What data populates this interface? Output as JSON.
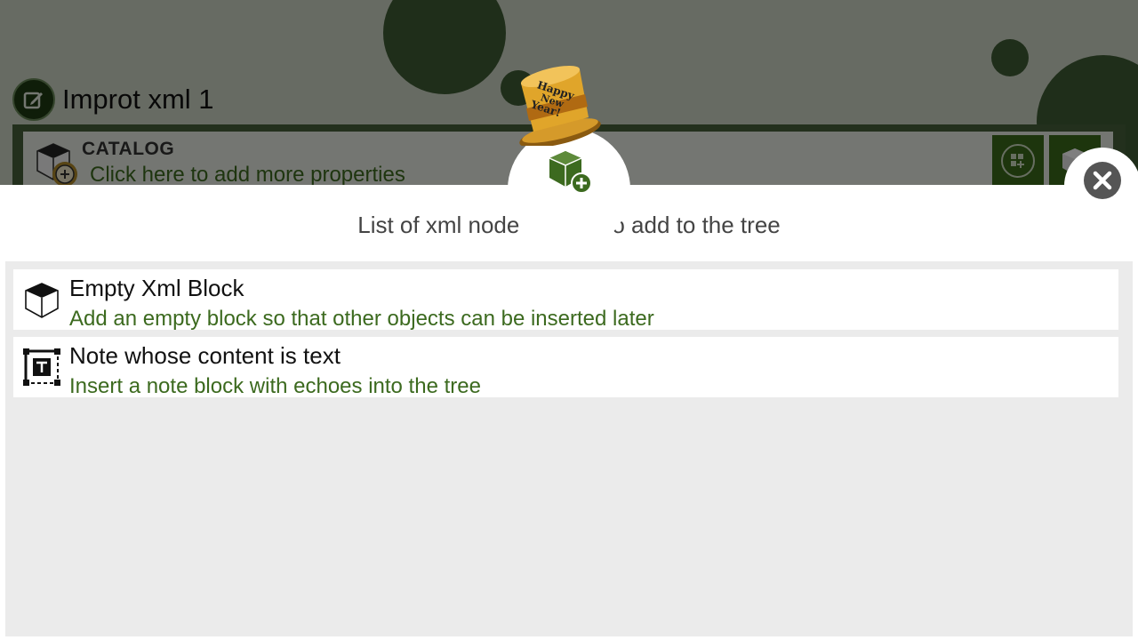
{
  "background": {
    "document_title": "Improt xml 1",
    "catalog": {
      "name": "CATALOG",
      "add_properties_link": "Click here to add more properties"
    }
  },
  "dialog": {
    "title": "List of xml node objects to add to the tree",
    "items": [
      {
        "icon": "cube-icon",
        "title": "Empty Xml Block",
        "description": "Add an empty block so that other objects can be inserted later"
      },
      {
        "icon": "text-note-icon",
        "title": "Note whose content is text",
        "description": "Insert a note block with echoes into the tree"
      }
    ],
    "badge_icon": "add-cube-icon",
    "close_icon": "close-icon"
  },
  "decoration": {
    "hat_text": "Happy New Year!"
  },
  "colors": {
    "accent_green": "#3c6a1f",
    "dark_green": "#46613a",
    "close_gray": "#555555"
  }
}
